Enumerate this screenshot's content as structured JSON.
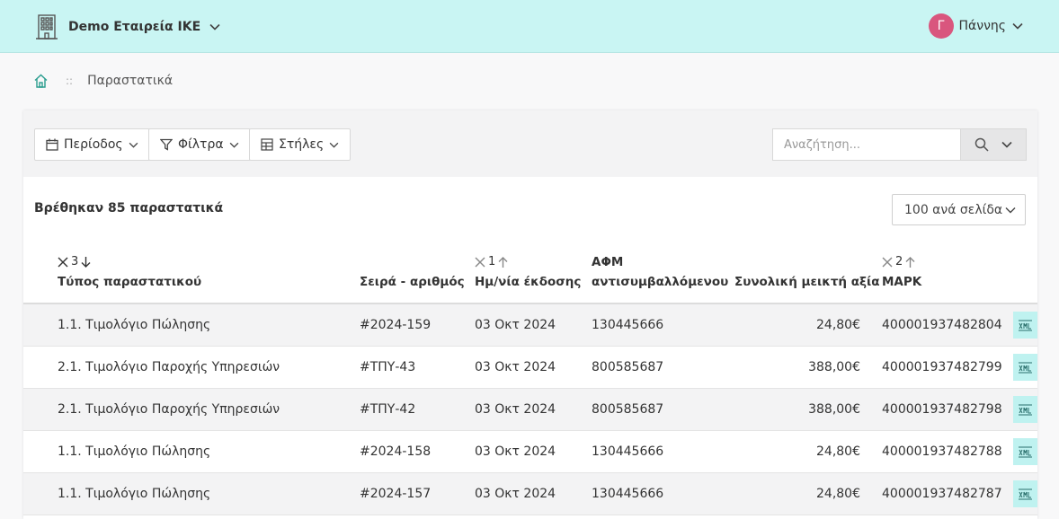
{
  "header": {
    "company": "Demo Εταιρεία ΙΚΕ",
    "user_initial": "Γ",
    "user_name": "Πάννης"
  },
  "breadcrumb": {
    "separator": "::",
    "current": "Παραστατικά"
  },
  "toolbar": {
    "period_label": "Περίοδος",
    "filters_label": "Φίλτρα",
    "columns_label": "Στήλες",
    "search_placeholder": "Αναζήτηση..."
  },
  "results": {
    "found_text": "Βρέθηκαν 85 παραστατικά",
    "per_page": "100 ανά σελίδα"
  },
  "table": {
    "columns": [
      {
        "label": "Τύπος παραστατικού",
        "sort_order": "3",
        "sort_dir": "desc"
      },
      {
        "label": "Σειρά - αριθμός"
      },
      {
        "label": "Ημ/νία έκδοσης",
        "sort_order": "1",
        "sort_dir": "asc"
      },
      {
        "label": "ΑΦΜ",
        "label2": "αντισυμβαλλόμενου"
      },
      {
        "label": "Συνολική μεικτή αξία"
      },
      {
        "label": "ΜΑΡΚ",
        "sort_order": "2",
        "sort_dir": "asc"
      }
    ],
    "rows": [
      {
        "type": "1.1. Τιμολόγιο Πώλησης",
        "series": "#2024-159",
        "date": "03 Οκτ 2024",
        "afm": "130445666",
        "amount": "24,80€",
        "mark": "400001937482804"
      },
      {
        "type": "2.1. Τιμολόγιο Παροχής Υπηρεσιών",
        "series": "#ΤΠΥ-43",
        "date": "03 Οκτ 2024",
        "afm": "800585687",
        "amount": "388,00€",
        "mark": "400001937482799"
      },
      {
        "type": "2.1. Τιμολόγιο Παροχής Υπηρεσιών",
        "series": "#ΤΠΥ-42",
        "date": "03 Οκτ 2024",
        "afm": "800585687",
        "amount": "388,00€",
        "mark": "400001937482798"
      },
      {
        "type": "1.1. Τιμολόγιο Πώλησης",
        "series": "#2024-158",
        "date": "03 Οκτ 2024",
        "afm": "130445666",
        "amount": "24,80€",
        "mark": "400001937482788"
      },
      {
        "type": "1.1. Τιμολόγιο Πώλησης",
        "series": "#2024-157",
        "date": "03 Οκτ 2024",
        "afm": "130445666",
        "amount": "24,80€",
        "mark": "400001937482787"
      }
    ],
    "row_action_icon": "xml-icon"
  },
  "colors": {
    "topbar_bg": "#c9f5f3",
    "avatar_bg": "#d9567e",
    "xml_button_bg": "#bff2f0",
    "alt_row_bg": "#f3f3f4"
  }
}
